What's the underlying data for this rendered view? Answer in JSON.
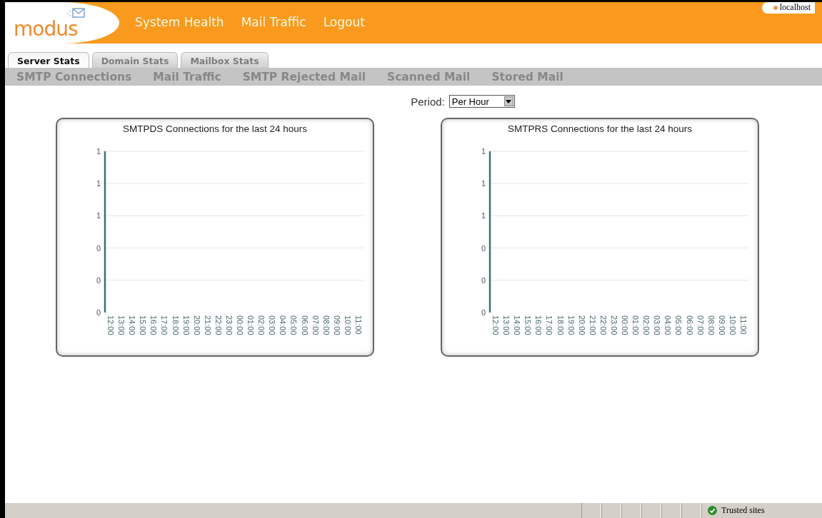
{
  "header": {
    "logo": "modus",
    "nav": [
      "System Health",
      "Mail Traffic",
      "Logout"
    ],
    "host": "localhost"
  },
  "tabs": [
    {
      "label": "Server Stats",
      "selected": true
    },
    {
      "label": "Domain Stats",
      "selected": false
    },
    {
      "label": "Mailbox Stats",
      "selected": false
    }
  ],
  "subnav": [
    "SMTP Connections",
    "Mail Traffic",
    "SMTP Rejected Mail",
    "Scanned Mail",
    "Stored Mail"
  ],
  "period": {
    "label": "Period:",
    "value": "Per Hour"
  },
  "charts": [
    {
      "chart_data": {
        "type": "line",
        "title": "SMTPDS Connections for the last 24 hours",
        "categories": [
          "12:00",
          "13:00",
          "14:00",
          "15:00",
          "16:00",
          "17:00",
          "18:00",
          "19:00",
          "20:00",
          "21:00",
          "22:00",
          "23:00",
          "00:00",
          "01:00",
          "02:00",
          "03:00",
          "04:00",
          "05:00",
          "06:00",
          "07:00",
          "08:00",
          "09:00",
          "10:00",
          "11:00"
        ],
        "ylim": [
          0,
          1
        ],
        "yticks": [
          {
            "value": 0,
            "label": "0"
          },
          {
            "value": 0.2,
            "label": "0"
          },
          {
            "value": 0.4,
            "label": "0"
          },
          {
            "value": 0.6,
            "label": "1"
          },
          {
            "value": 0.8,
            "label": "1"
          },
          {
            "value": 1,
            "label": "1"
          }
        ],
        "grid": true
      }
    },
    {
      "chart_data": {
        "type": "line",
        "title": "SMTPRS Connections for the last 24 hours",
        "categories": [
          "12:00",
          "13:00",
          "14:00",
          "15:00",
          "16:00",
          "17:00",
          "18:00",
          "19:00",
          "20:00",
          "21:00",
          "22:00",
          "23:00",
          "00:00",
          "01:00",
          "02:00",
          "03:00",
          "04:00",
          "05:00",
          "06:00",
          "07:00",
          "08:00",
          "09:00",
          "10:00",
          "11:00"
        ],
        "ylim": [
          0,
          1
        ],
        "yticks": [
          {
            "value": 0,
            "label": "0"
          },
          {
            "value": 0.2,
            "label": "0"
          },
          {
            "value": 0.4,
            "label": "0"
          },
          {
            "value": 0.6,
            "label": "1"
          },
          {
            "value": 0.8,
            "label": "1"
          },
          {
            "value": 1,
            "label": "1"
          }
        ],
        "grid": true
      }
    }
  ],
  "status_bar": {
    "zone": "Trusted sites"
  }
}
